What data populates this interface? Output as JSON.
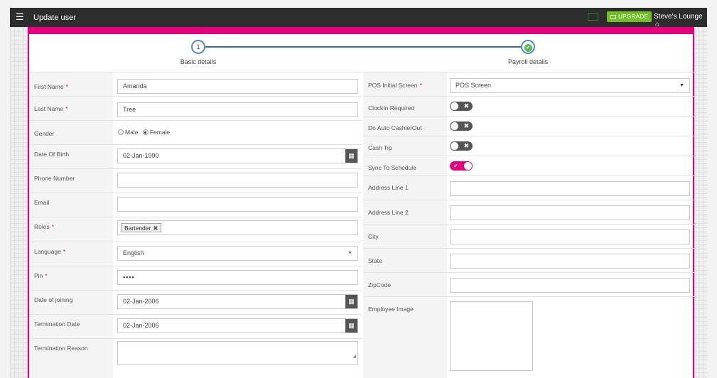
{
  "header": {
    "title": "Update user",
    "upgrade_label": "UPGRADE",
    "venue": "Steve's Lounge",
    "icons": [
      "menu-icon",
      "screen-icon",
      "gift-icon",
      "home-icon"
    ]
  },
  "steps": [
    {
      "number": "1",
      "label": "Basic details"
    },
    {
      "number": "",
      "label": "Payroll details"
    }
  ],
  "left_form": {
    "first_name": {
      "label": "First Name",
      "value": "Amanda"
    },
    "last_name": {
      "label": "Last Name",
      "value": "Tree"
    },
    "gender": {
      "label": "Gender",
      "options": [
        "Male",
        "Female"
      ],
      "selected": "Female"
    },
    "dob": {
      "label": "Date Of Birth",
      "value": "02-Jan-1990"
    },
    "phone": {
      "label": "Phone Number",
      "value": ""
    },
    "email": {
      "label": "Email",
      "value": ""
    },
    "roles": {
      "label": "Roles",
      "tags": [
        "Bartender"
      ]
    },
    "language": {
      "label": "Language",
      "value": "English"
    },
    "pin": {
      "label": "Pin",
      "value": "••••"
    },
    "doj": {
      "label": "Date of joining",
      "value": "02-Jan-2006"
    },
    "termination_date": {
      "label": "Termination Date",
      "value": "02-Jan-2006"
    },
    "termination_reason": {
      "label": "Termination Reason",
      "value": ""
    }
  },
  "right_form": {
    "pos_screen": {
      "label": "POS Initial Screen",
      "value": "POS Screen"
    },
    "clockin": {
      "label": "ClockIn Required",
      "on": false
    },
    "auto_cashier": {
      "label": "Do Auto CashierOut",
      "on": false
    },
    "cash_tip": {
      "label": "Cash Tip",
      "on": false
    },
    "sync_schedule": {
      "label": "Sync To Schedule",
      "on": true
    },
    "address1": {
      "label": "Address Line 1",
      "value": ""
    },
    "address2": {
      "label": "Address Line 2",
      "value": ""
    },
    "city": {
      "label": "City",
      "value": ""
    },
    "state": {
      "label": "State",
      "value": ""
    },
    "zip": {
      "label": "ZipCode",
      "value": ""
    },
    "employee_image": {
      "label": "Employee Image"
    }
  },
  "colors": {
    "accent": "#e6007e",
    "topbar": "#2d2d2d",
    "upgrade": "#6fbf25",
    "step": "#4f8ec6"
  }
}
